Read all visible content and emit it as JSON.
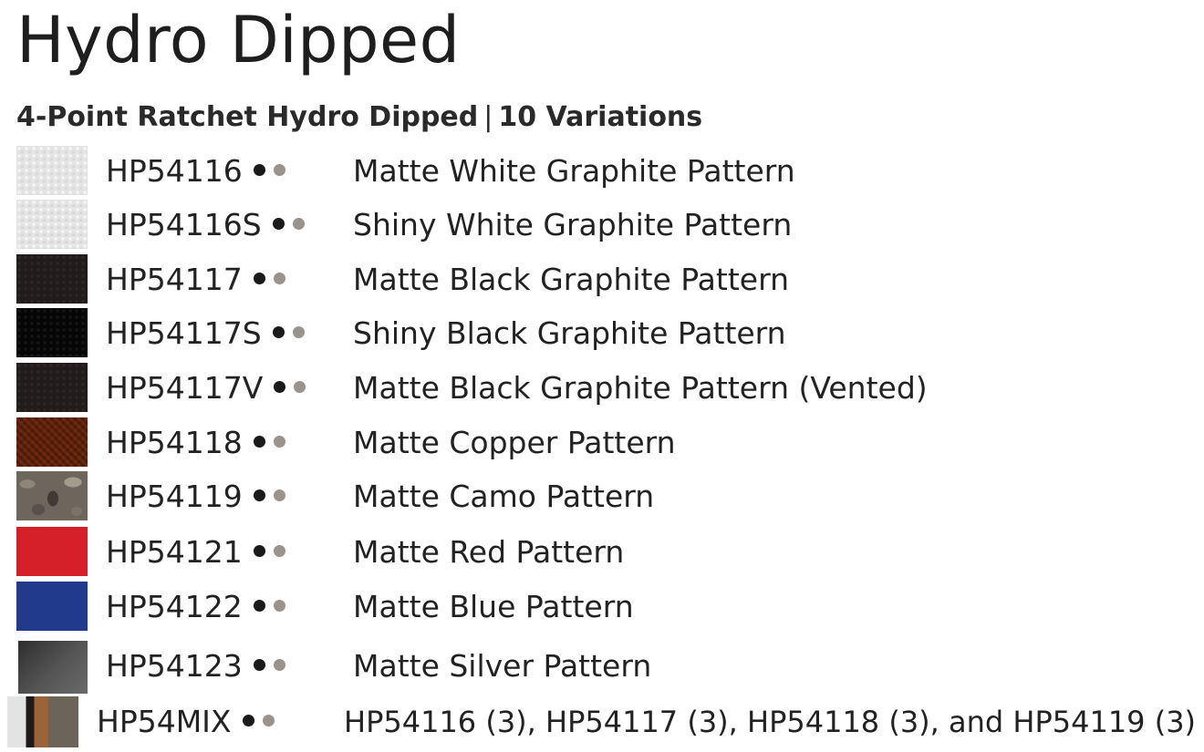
{
  "header": {
    "title": "Hydro Dipped",
    "subtitle_product": "4-Point Ratchet Hydro Dipped",
    "subtitle_separator": "|",
    "subtitle_count": "10 Variations"
  },
  "colors": {
    "dot_dark": "#1a1a1a",
    "dot_grey": "#9a928c"
  },
  "items": [
    {
      "code": "HP54116",
      "description": "Matte White Graphite Pattern",
      "swatch": "white graphite texture"
    },
    {
      "code": "HP54116S",
      "description": "Shiny White Graphite Pattern",
      "swatch": "white graphite texture"
    },
    {
      "code": "HP54117",
      "description": "Matte Black Graphite Pattern",
      "swatch": "black graphite texture"
    },
    {
      "code": "HP54117S",
      "description": "Shiny Black Graphite Pattern",
      "swatch": "shiny black graphite texture"
    },
    {
      "code": "HP54117V",
      "description": "Matte Black Graphite Pattern (Vented)",
      "swatch": "black graphite texture"
    },
    {
      "code": "HP54118",
      "description": "Matte Copper Pattern",
      "swatch": "copper weave texture"
    },
    {
      "code": "HP54119",
      "description": "Matte Camo Pattern",
      "swatch": "camo texture"
    },
    {
      "code": "HP54121",
      "description": "Matte Red Pattern",
      "swatch": "red"
    },
    {
      "code": "HP54122",
      "description": "Matte Blue Pattern",
      "swatch": "blue"
    },
    {
      "code": "HP54123",
      "description": "Matte Silver Pattern",
      "swatch": "silver gradient"
    },
    {
      "code": "HP54MIX",
      "description": "HP54116 (3), HP54117 (3), HP54118 (3), and HP54119 (3)",
      "swatch": "mixed strips"
    }
  ]
}
